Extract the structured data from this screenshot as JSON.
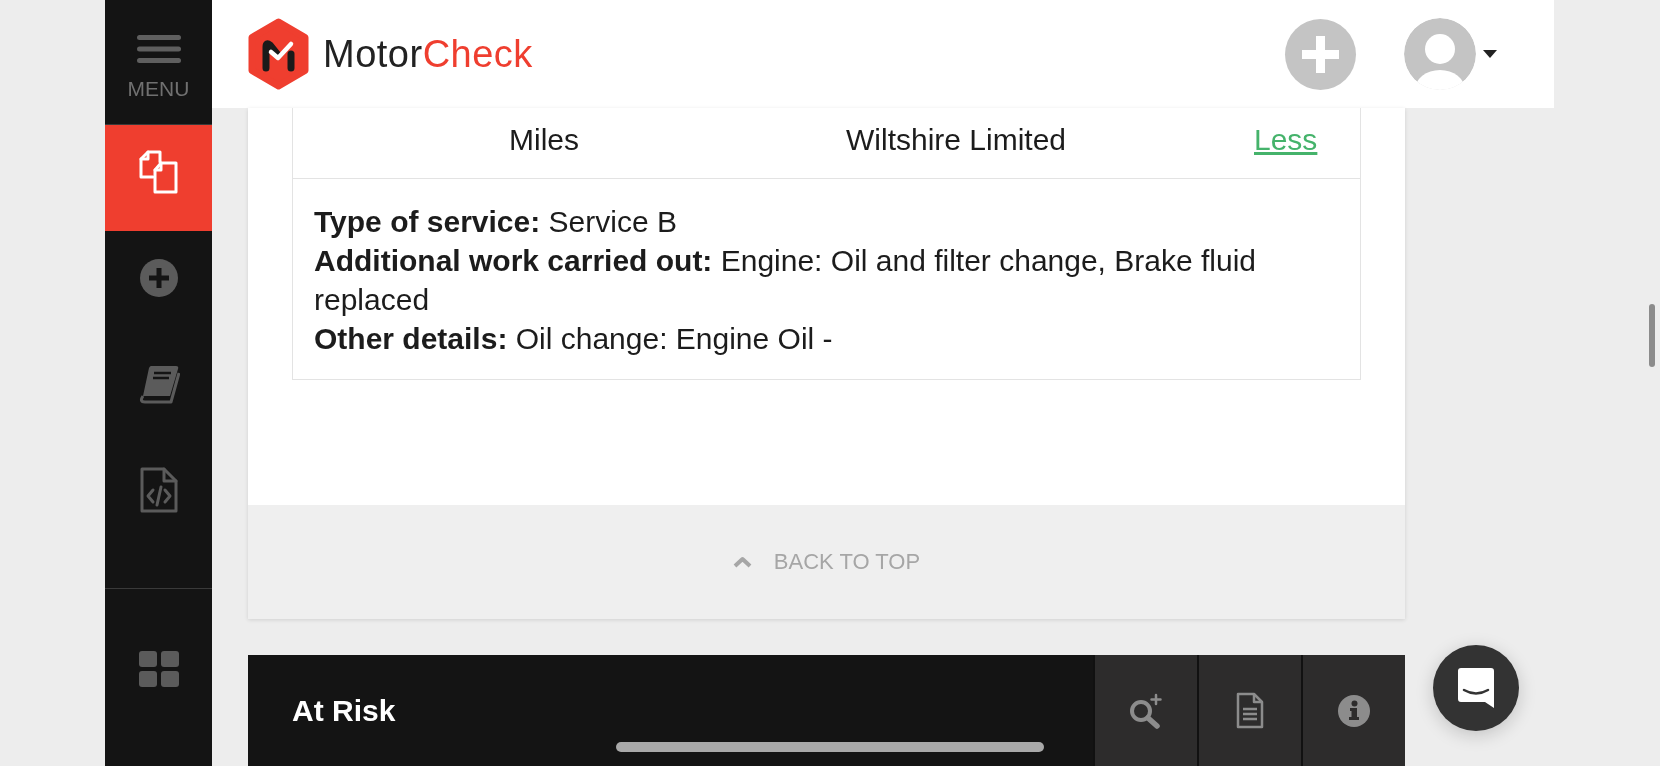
{
  "sidebar": {
    "menu_label": "MENU",
    "items": [
      {
        "kind": "documents",
        "selected": true
      },
      {
        "kind": "add",
        "selected": false
      },
      {
        "kind": "book",
        "selected": false
      },
      {
        "kind": "code-file",
        "selected": false
      }
    ],
    "footer_items": [
      {
        "kind": "grid",
        "selected": false
      }
    ]
  },
  "header": {
    "logo": [
      "Motor",
      "Check"
    ]
  },
  "service_history": {
    "visible_row": {
      "column_2": "Miles",
      "column_4": "Wiltshire Limited",
      "toggle_link": "Less"
    },
    "details": [
      "**Type of service:** Service B",
      "**Additional work carried out:** Engine: Oil and filter change, Brake fluid replaced",
      "**Other details:** Oil change: Engine Oil -"
    ],
    "back_to_top": "BACK TO TOP"
  },
  "at_risk": {
    "title": "At Risk",
    "actions": [
      {
        "kind": "zoom-in"
      },
      {
        "kind": "document"
      },
      {
        "kind": "info"
      }
    ]
  }
}
